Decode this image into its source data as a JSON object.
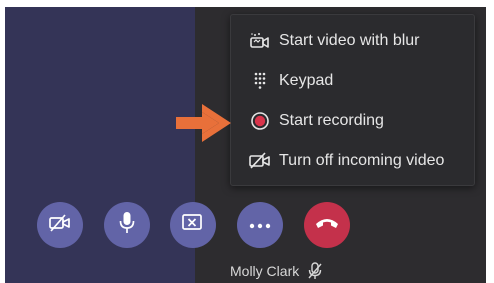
{
  "menu": {
    "items": [
      {
        "label": "Start video with blur",
        "icon": "video-blur-icon"
      },
      {
        "label": "Keypad",
        "icon": "keypad-icon"
      },
      {
        "label": "Start recording",
        "icon": "record-icon"
      },
      {
        "label": "Turn off incoming video",
        "icon": "video-off-icon"
      }
    ]
  },
  "controls": [
    {
      "name": "camera-off",
      "icon": "camera-off-icon"
    },
    {
      "name": "microphone",
      "icon": "microphone-icon"
    },
    {
      "name": "stop-share",
      "icon": "stop-share-icon"
    },
    {
      "name": "more-actions",
      "icon": "more-icon"
    },
    {
      "name": "hang-up",
      "icon": "hang-up-icon"
    }
  ],
  "participant": {
    "name": "Molly Clark",
    "status_icon": "mic-muted-icon"
  },
  "colors": {
    "left_panel": "#343457",
    "background": "#2d2c2f",
    "menu_bg": "#2b2b2e",
    "control_purple": "#6264a7",
    "hangup_red": "#c4314b",
    "record_red": "#d9344b",
    "arrow_orange": "#e8703a"
  }
}
